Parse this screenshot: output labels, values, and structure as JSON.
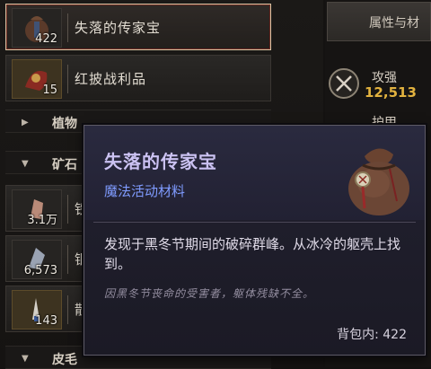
{
  "inventory": {
    "items": [
      {
        "name": "失落的传家宝",
        "count": "422",
        "selected": true
      },
      {
        "name": "红披战利品",
        "count": "15",
        "selected": false
      }
    ],
    "categories": [
      {
        "label": "植物",
        "state": "collapsed"
      },
      {
        "label": "矿石",
        "state": "expanded"
      },
      {
        "label": "皮毛",
        "state": "expanded"
      }
    ],
    "partial_items": [
      {
        "name": "铁",
        "count": "3.1万"
      },
      {
        "name": "银",
        "count": "6,573"
      },
      {
        "name": "散",
        "count": "143"
      }
    ]
  },
  "side_panel": {
    "tab_label": "属性与材",
    "stat1_label": "攻强",
    "stat1_value": "12,513",
    "stat2_label": "护甲"
  },
  "tooltip": {
    "title": "失落的传家宝",
    "type": "魔法活动材料",
    "description": "发现于黑冬节期间的破碎群峰。从冰冷的躯壳上找到。",
    "flavor": "因黑冬节丧命的受害者，躯体残缺不全。",
    "footer": "背包内: 422"
  },
  "colors": {
    "tooltip_title": "#cbc2f2",
    "tooltip_type": "#7f9bff",
    "stat_value": "#e2b23f",
    "selected_border": "#d9c4a4"
  }
}
